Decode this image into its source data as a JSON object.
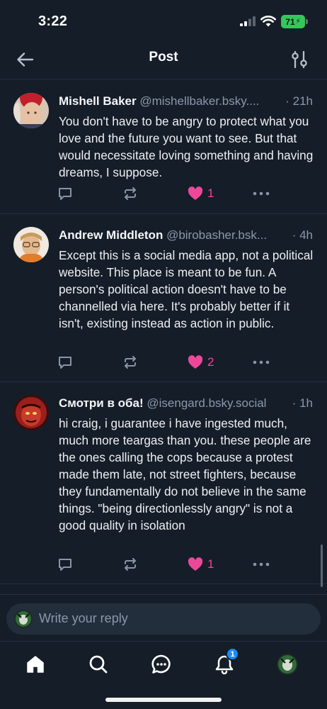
{
  "status_bar": {
    "time": "3:22",
    "battery": "71"
  },
  "header": {
    "title": "Post",
    "back_icon": "arrow-left-icon",
    "filter_icon": "sliders-icon"
  },
  "posts": [
    {
      "author": "Mishell Baker",
      "handle": "@mishellbaker.bsky....",
      "time": "· 21h",
      "text": "You don't have to be angry to protect what you love and the future you want to see.  But that would necessitate loving something and having dreams, I suppose.",
      "likes": "1"
    },
    {
      "author": "Andrew Middleton",
      "handle": "@birobasher.bsk...",
      "time": "· 4h",
      "text": "Except this is a social media app, not a political website. This place is meant to be fun. A person's political action doesn't have to be channelled via here. It's probably better if it isn't,  existing instead as action in public.",
      "likes": "2"
    },
    {
      "author": "Смотри в оба!",
      "handle": "@isengard.bsky.social",
      "time": "· 1h",
      "text": "hi craig, i guarantee i have ingested much, much more teargas than you. these people are the ones calling the cops because a protest made them late, not street fighters, because they fundamentally do not believe in the same things. \"being directionlessly angry\" is not a good quality in isolation",
      "likes": "1"
    }
  ],
  "reply": {
    "placeholder": "Write your reply"
  },
  "nav": {
    "items": [
      "home-icon",
      "search-icon",
      "chat-icon",
      "bell-icon",
      "profile-avatar"
    ],
    "notification_badge": "1"
  },
  "colors": {
    "background": "#151d28",
    "like_pink": "#ec4899",
    "accent_blue": "#1d8bf1",
    "muted_text": "#8a98ab"
  }
}
